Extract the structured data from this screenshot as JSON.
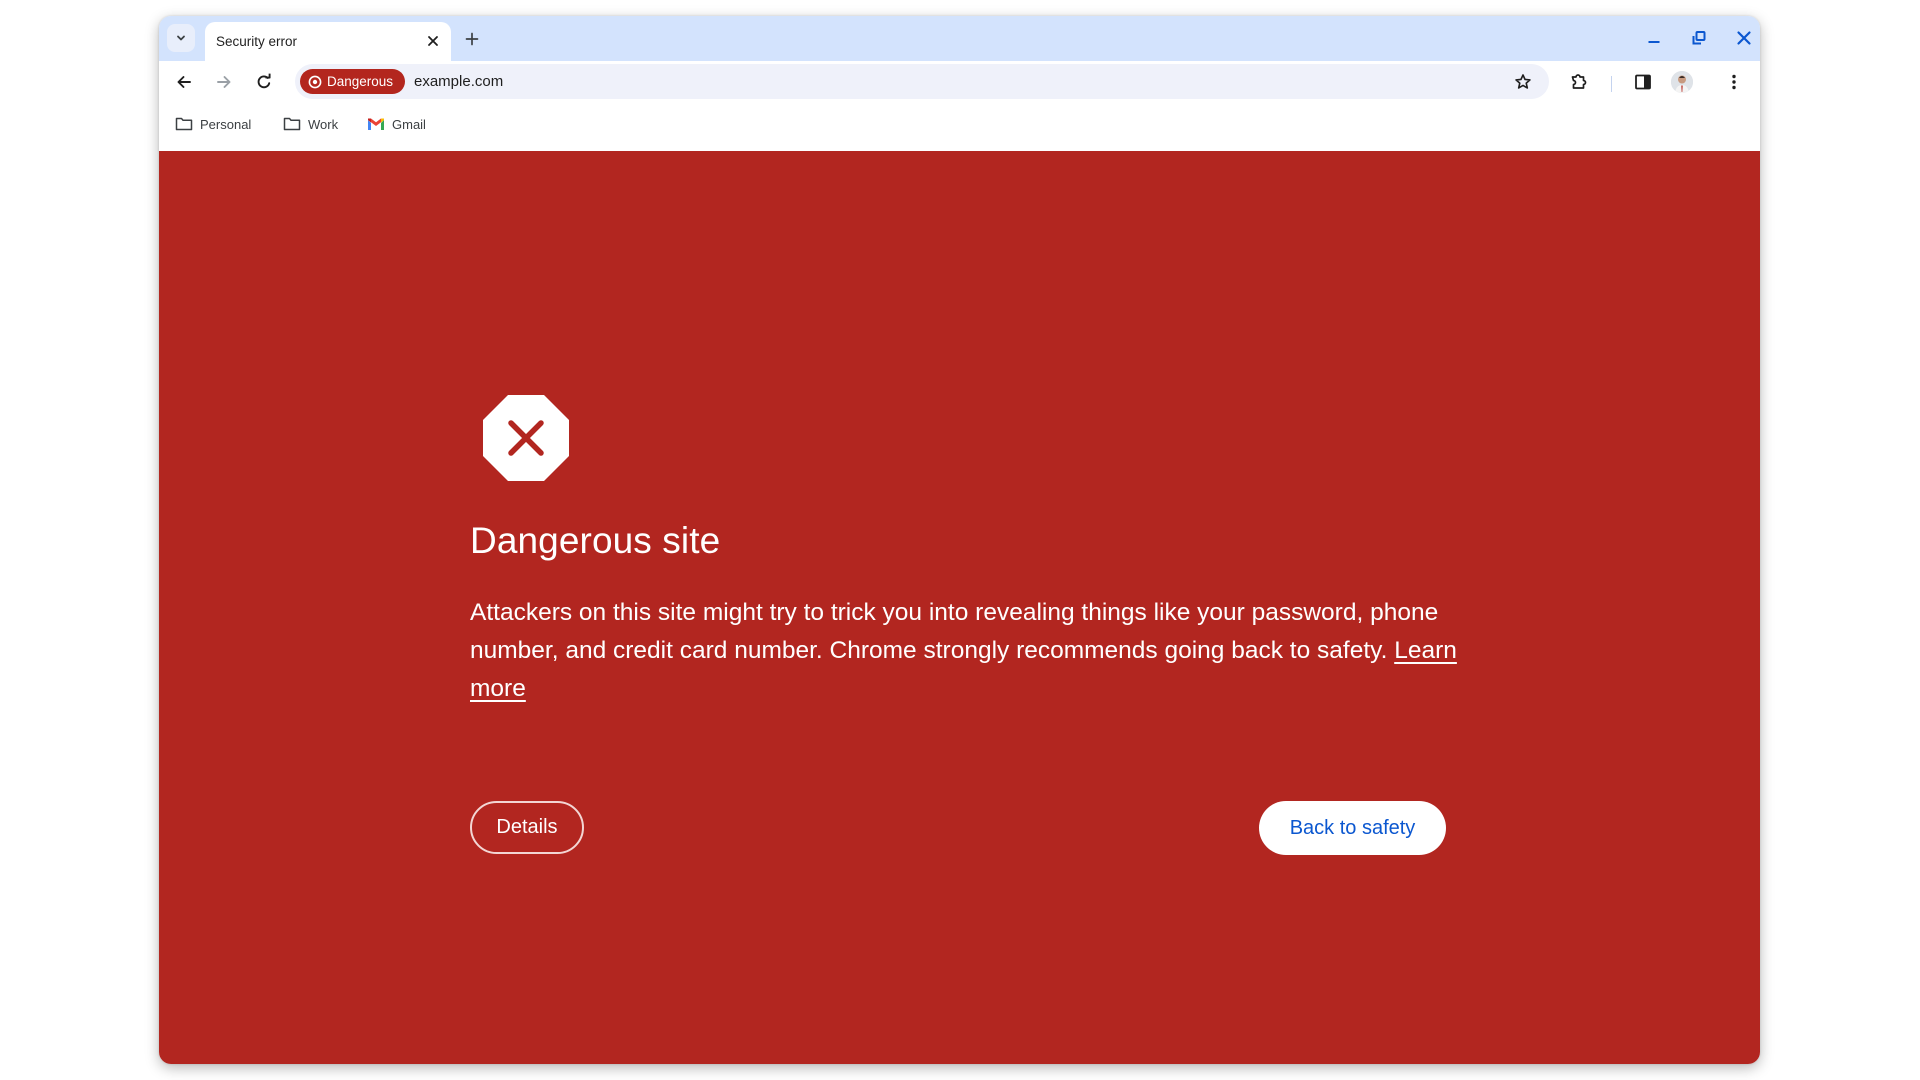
{
  "browser": {
    "tab": {
      "title": "Security error"
    },
    "window_controls": {
      "minimize": "minimize-icon",
      "restore": "restore-icon",
      "close": "close-icon"
    },
    "omnibox": {
      "security_chip_label": "Dangerous",
      "url": "example.com"
    },
    "bookmarks": [
      {
        "label": "Personal",
        "icon": "folder-icon"
      },
      {
        "label": "Work",
        "icon": "folder-icon"
      },
      {
        "label": "Gmail",
        "icon": "gmail-icon"
      }
    ],
    "colors": {
      "tabstrip": "#d3e3fd",
      "omnibox": "#eff1fa",
      "chip": "#b3261e",
      "accent": "#0b57d0"
    }
  },
  "interstitial": {
    "background_color": "#b22620",
    "heading": "Dangerous site",
    "body_text": "Attackers on this site might try to trick you into revealing things like your password, phone number, and credit card number. Chrome strongly recommends going back to safety.",
    "learn_more": "Learn more",
    "details_button": "Details",
    "back_button": "Back to safety"
  }
}
